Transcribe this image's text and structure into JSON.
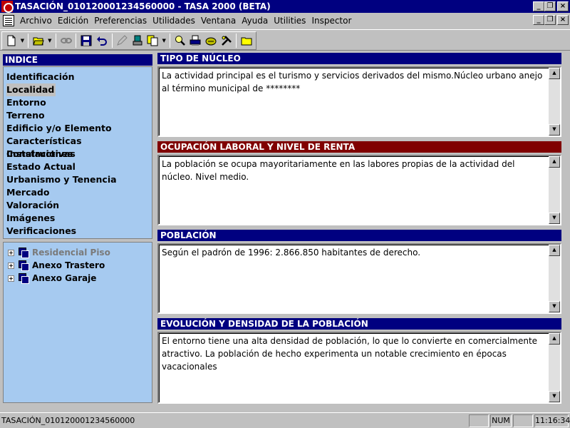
{
  "window": {
    "title": "TASACIÓN_010120001234560000 - TASA 2000 (BETA)",
    "min_glyph": "_",
    "restore_glyph": "❐",
    "close_glyph": "×"
  },
  "menu": {
    "items": [
      "Archivo",
      "Edición",
      "Preferencias",
      "Utilidades",
      "Ventana",
      "Ayuda",
      "Utilities",
      "Inspector"
    ]
  },
  "toolbar": {
    "icons": [
      "new-document-icon",
      "open-folder-icon",
      "link-icon",
      "save-icon",
      "undo-icon",
      "edit-icon",
      "stamp-icon",
      "copy-icon",
      "search-icon",
      "print-icon",
      "export-icon",
      "tools-icon",
      "folder-icon"
    ]
  },
  "index": {
    "header": "INDICE",
    "items": [
      "Identificación",
      "Localidad",
      "Entorno",
      "Terreno",
      "Edificio y/o Elemento",
      "Características Constructivas",
      "Instalaciones",
      "Estado Actual",
      "Urbanismo y Tenencia",
      "Mercado",
      "Valoración",
      "Imágenes",
      "Verificaciones"
    ],
    "selected": "Localidad"
  },
  "tree": {
    "nodes": [
      {
        "label": "Residencial Piso",
        "disabled": true
      },
      {
        "label": "Anexo Trastero",
        "disabled": false
      },
      {
        "label": "Anexo Garaje",
        "disabled": false
      }
    ]
  },
  "sections": [
    {
      "title": "TIPO DE NÚCLEO",
      "color": "#000080",
      "text": "La actividad principal es el turismo y servicios derivados del mismo.Núcleo urbano anejo al término municipal de ********"
    },
    {
      "title": "OCUPACIÓN LABORAL Y NIVEL DE RENTA",
      "color": "#800000",
      "text": "La población se ocupa mayoritariamente en las labores propias de la actividad del núcleo. Nivel medio."
    },
    {
      "title": "POBLACIÓN",
      "color": "#000080",
      "text": "Según el padrón de 1996: 2.866.850 habitantes de derecho."
    },
    {
      "title": "EVOLUCIÓN Y DENSIDAD DE LA POBLACIÓN",
      "color": "#000080",
      "text": "El entorno tiene una alta densidad de población, lo que lo convierte en comercialmente atractivo. La población de hecho experimenta un notable crecimiento en épocas vacacionales"
    }
  ],
  "status": {
    "text": "TASACIÓN_010120001234560000",
    "num": "NUM",
    "time": "11:16:34"
  }
}
